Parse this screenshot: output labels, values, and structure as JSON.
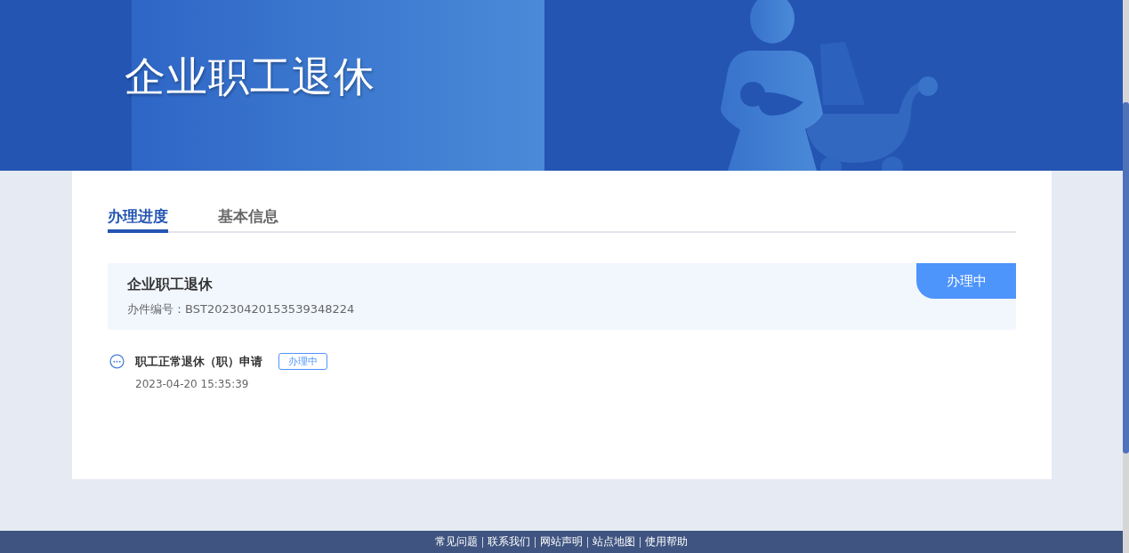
{
  "banner": {
    "title": "企业职工退休"
  },
  "tabs": [
    {
      "label": "办理进度",
      "selected": true
    },
    {
      "label": "基本信息",
      "selected": false
    }
  ],
  "record": {
    "title": "企业职工退休",
    "number": "办件编号：BST20230420153539348224",
    "status": "办理中"
  },
  "steps": [
    {
      "kind": "pending",
      "title": "职工正常退休（职）申请",
      "status": "办理中",
      "time": "2023-04-20 15:35:39"
    }
  ],
  "footer": {
    "links": [
      "常见问题",
      "联系我们",
      "网站声明",
      "站点地图",
      "使用帮助"
    ]
  }
}
